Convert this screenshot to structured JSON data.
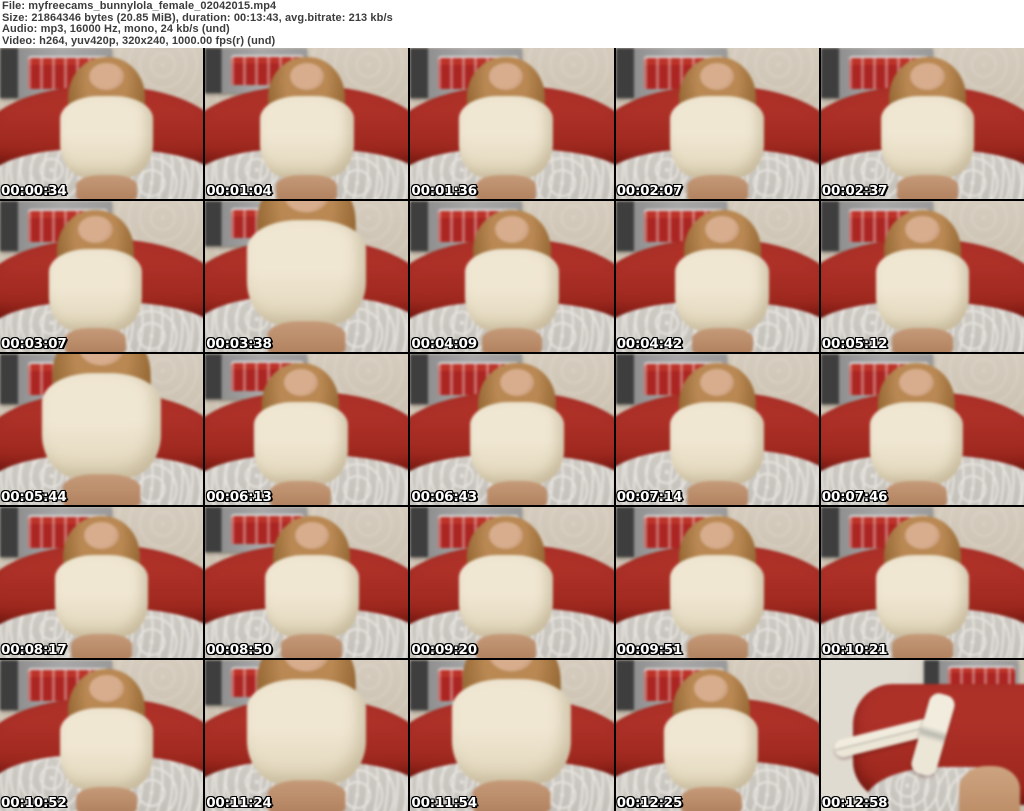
{
  "header": {
    "lines": [
      "File: myfreecams_bunnylola_female_02042015.mp4",
      "Size: 21864346 bytes (20.85 MiB), duration: 00:13:43, avg.bitrate: 213 kb/s",
      "Audio: mp3, 16000 Hz, mono, 24 kb/s (und)",
      "Video: h264, yuv420p, 320x240, 1000.00 fps(r) (und)"
    ]
  },
  "grid": {
    "columns": 5,
    "rows": 5,
    "thumbnails": [
      {
        "timestamp": "00:00:34",
        "scene": "seated"
      },
      {
        "timestamp": "00:01:04",
        "scene": "seated"
      },
      {
        "timestamp": "00:01:36",
        "scene": "seated"
      },
      {
        "timestamp": "00:02:07",
        "scene": "seated"
      },
      {
        "timestamp": "00:02:37",
        "scene": "seated"
      },
      {
        "timestamp": "00:03:07",
        "scene": "seated"
      },
      {
        "timestamp": "00:03:38",
        "scene": "closeup"
      },
      {
        "timestamp": "00:04:09",
        "scene": "seated"
      },
      {
        "timestamp": "00:04:42",
        "scene": "seated"
      },
      {
        "timestamp": "00:05:12",
        "scene": "seated"
      },
      {
        "timestamp": "00:05:44",
        "scene": "closeup"
      },
      {
        "timestamp": "00:06:13",
        "scene": "seated"
      },
      {
        "timestamp": "00:06:43",
        "scene": "seated"
      },
      {
        "timestamp": "00:07:14",
        "scene": "seated"
      },
      {
        "timestamp": "00:07:46",
        "scene": "seated"
      },
      {
        "timestamp": "00:08:17",
        "scene": "seated"
      },
      {
        "timestamp": "00:08:50",
        "scene": "seated"
      },
      {
        "timestamp": "00:09:20",
        "scene": "seated"
      },
      {
        "timestamp": "00:09:51",
        "scene": "seated"
      },
      {
        "timestamp": "00:10:21",
        "scene": "seated"
      },
      {
        "timestamp": "00:10:52",
        "scene": "seated"
      },
      {
        "timestamp": "00:11:24",
        "scene": "closeup"
      },
      {
        "timestamp": "00:11:54",
        "scene": "closeup"
      },
      {
        "timestamp": "00:12:25",
        "scene": "seated"
      },
      {
        "timestamp": "00:12:58",
        "scene": "legs"
      }
    ]
  },
  "palette": {
    "header_text": "#3c3c3c",
    "page_background": "#ffffff",
    "grid_gap": "#000000",
    "timestamp_text": "#ffffff",
    "timestamp_outline": "#000000",
    "couch_red": "#a5281d",
    "bus_red": "#b12420",
    "sweater_cream": "#ece2cb",
    "hair_auburn": "#9a6a33",
    "wall_beige": "#cdc3b2",
    "blanket_gray": "#c9c5bf"
  }
}
